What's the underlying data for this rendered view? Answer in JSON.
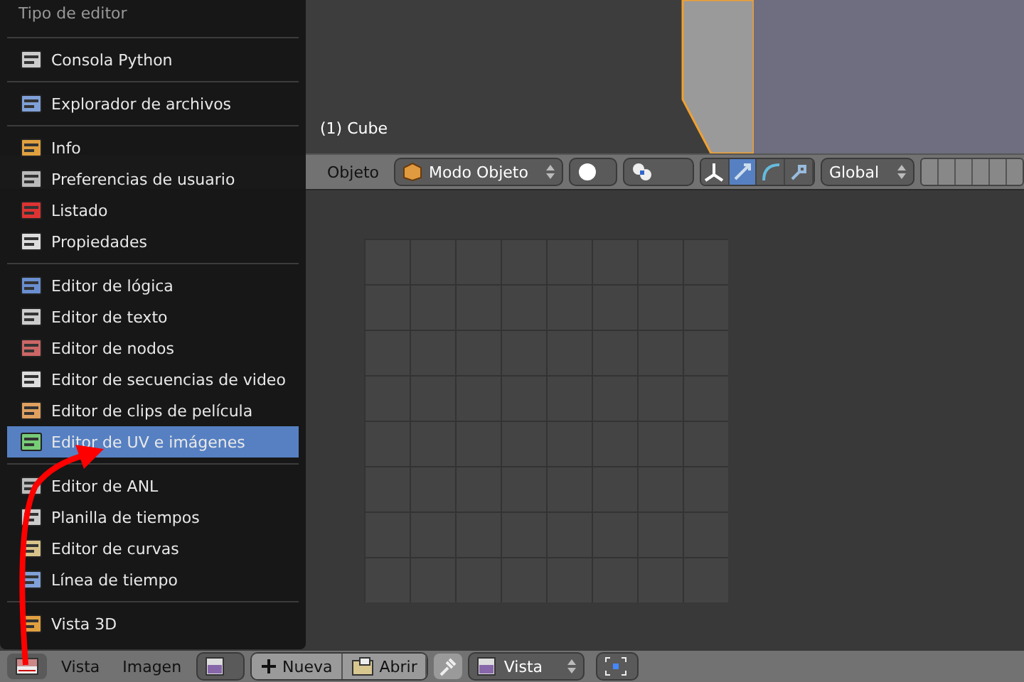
{
  "viewport": {
    "label": "(1) Cube"
  },
  "header": {
    "menu": "Objeto",
    "mode": "Modo Objeto",
    "orientation": "Global",
    "manipulators": [
      {
        "selected": false
      },
      {
        "selected": true
      },
      {
        "selected": false
      },
      {
        "selected": false
      }
    ]
  },
  "menu": {
    "title": "Tipo de editor",
    "items": [
      {
        "kind": "item",
        "label": "Consola Python",
        "selected": false
      },
      {
        "kind": "separator"
      },
      {
        "kind": "item",
        "label": "Explorador de archivos",
        "selected": false
      },
      {
        "kind": "separator"
      },
      {
        "kind": "item",
        "label": "Info",
        "selected": false
      },
      {
        "kind": "item",
        "label": "Preferencias de usuario",
        "selected": false
      },
      {
        "kind": "item",
        "label": "Listado",
        "selected": false
      },
      {
        "kind": "item",
        "label": "Propiedades",
        "selected": false
      },
      {
        "kind": "separator"
      },
      {
        "kind": "item",
        "label": "Editor de lógica",
        "selected": false
      },
      {
        "kind": "item",
        "label": "Editor de texto",
        "selected": false
      },
      {
        "kind": "item",
        "label": "Editor de nodos",
        "selected": false
      },
      {
        "kind": "item",
        "label": "Editor de secuencias de video",
        "selected": false
      },
      {
        "kind": "item",
        "label": "Editor de clips de película",
        "selected": false
      },
      {
        "kind": "item",
        "label": "Editor de UV e imágenes",
        "selected": true
      },
      {
        "kind": "separator"
      },
      {
        "kind": "item",
        "label": "Editor de ANL",
        "selected": false
      },
      {
        "kind": "item",
        "label": "Planilla de tiempos",
        "selected": false
      },
      {
        "kind": "item",
        "label": "Editor de curvas",
        "selected": false
      },
      {
        "kind": "item",
        "label": "Línea de tiempo",
        "selected": false
      },
      {
        "kind": "separator"
      },
      {
        "kind": "item",
        "label": "Vista 3D",
        "selected": false
      }
    ]
  },
  "bottom_bar": {
    "menus": [
      "Vista",
      "Imagen"
    ],
    "new_button": "Nueva",
    "open_button": "Abrir",
    "view_select": "Vista"
  }
}
